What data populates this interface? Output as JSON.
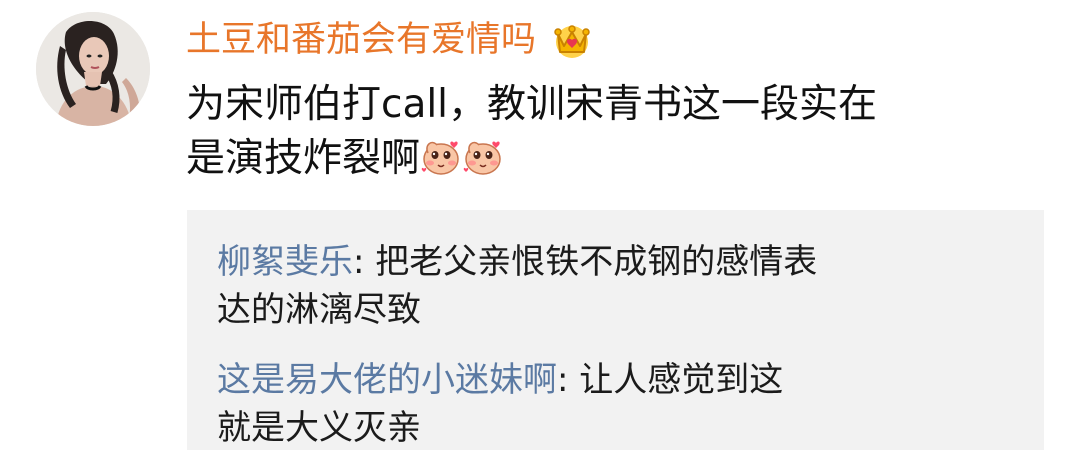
{
  "comment": {
    "username": "土豆和番茄会有爱情吗",
    "badge_icon": "crown-icon",
    "text_line1": "为宋师伯打call，教训宋青书这一段实在",
    "text_line2": "是演技炸裂啊",
    "emojis": [
      "cute-blush-emoji",
      "cute-blush-emoji"
    ],
    "username_color": "#e8762a"
  },
  "replies": [
    {
      "user": "柳絮斐乐",
      "separator": ": ",
      "text_line1": "把老父亲恨铁不成钢的感情表",
      "text_line2": "达的淋漓尽致"
    },
    {
      "user": "这是易大佬的小迷妹啊",
      "separator": ": ",
      "text_line1": "让人感觉到这",
      "text_line2": "就是大义灭亲"
    }
  ],
  "colors": {
    "reply_user": "#5b7aa3",
    "reply_background": "#f2f2f2"
  }
}
